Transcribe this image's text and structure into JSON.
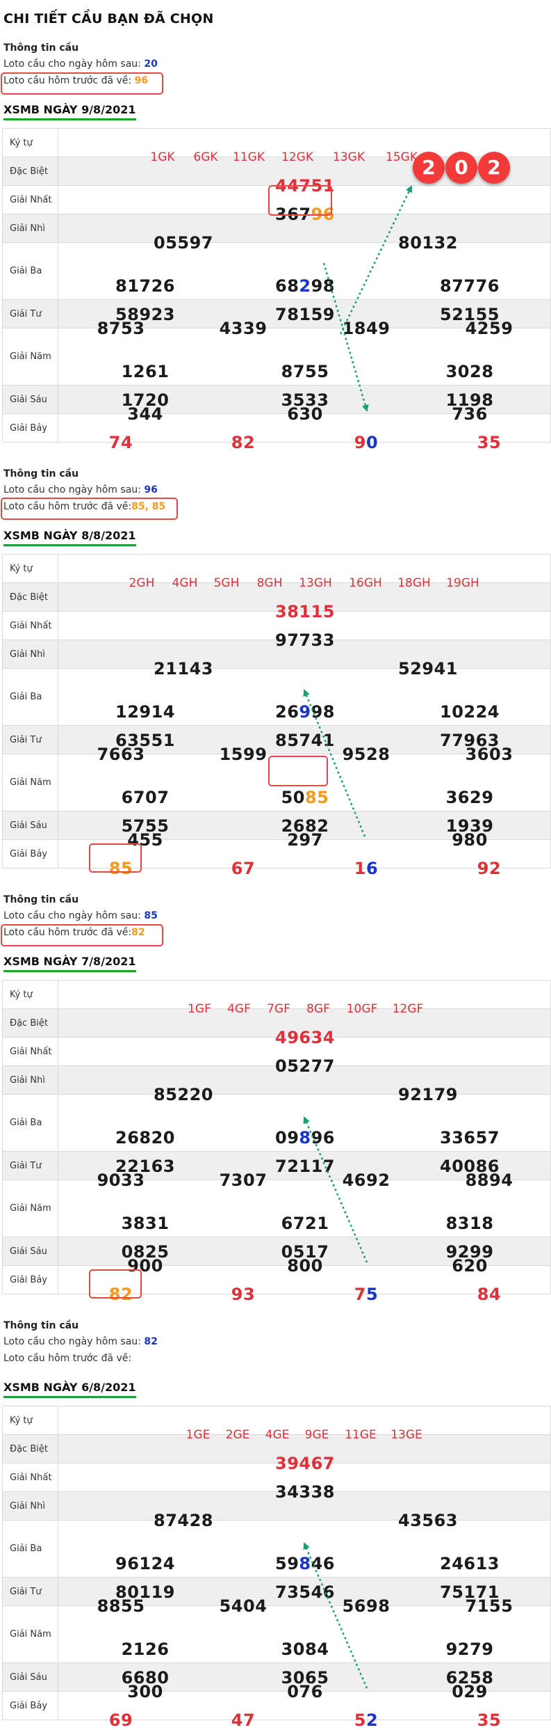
{
  "page_title": "CHI TIẾT CẦU BẠN ĐÃ CHỌN",
  "colors": {
    "red": "#e0303a",
    "blue": "#1a35c7",
    "orange": "#f59a1d",
    "green": "#18a32e",
    "dotted": "#1a9e7a"
  },
  "row_labels": {
    "ky_tu": "Ký tự",
    "db": "Đặc Biệt",
    "g1": "Giải Nhất",
    "g2": "Giải Nhì",
    "g3": "Giải Ba",
    "g4": "Giải Tư",
    "g5": "Giải Năm",
    "g6": "Giải Sáu",
    "g7": "Giải Bảy"
  },
  "badge": [
    "2",
    "0",
    "2"
  ],
  "sections": [
    {
      "info": {
        "heading": "Thông tin cầu",
        "next_label": "Loto cầu cho ngày hôm sau: ",
        "next_value": "20",
        "prev_label": "Loto cầu hôm trước đã về: ",
        "prev_value": "96"
      },
      "title": "XSMB NGÀY 9/8/2021",
      "kytu": [
        "1GK",
        "6GK",
        "11GK",
        "12GK",
        "13GK",
        "15GK"
      ],
      "db": "44751",
      "g1": {
        "a": "367",
        "b": "96"
      },
      "g2": [
        "05597",
        "80132"
      ],
      "g3": [
        {
          "a": "81726",
          "b": "",
          "c": ""
        },
        {
          "a": "68",
          "b": "2",
          "c": "98"
        },
        {
          "a": "87776",
          "b": "",
          "c": ""
        },
        {
          "a": "58923",
          "b": "",
          "c": ""
        },
        {
          "a": "78159",
          "b": "",
          "c": ""
        },
        {
          "a": "52155",
          "b": "",
          "c": ""
        }
      ],
      "g4": [
        "8753",
        "4339",
        "1849",
        "4259"
      ],
      "g5": [
        "1261",
        "8755",
        "3028",
        "1720",
        "3533",
        "1198"
      ],
      "g6": [
        "344",
        "630",
        "736"
      ],
      "g7": [
        {
          "a": "74",
          "b": ""
        },
        {
          "a": "82",
          "b": ""
        },
        {
          "a": "9",
          "b": "0"
        },
        {
          "a": "35",
          "b": ""
        }
      ]
    },
    {
      "info": {
        "heading": "Thông tin cầu",
        "next_label": "Loto cầu cho ngày hôm sau: ",
        "next_value": "96",
        "prev_label": "Loto cầu hôm trước đã về:",
        "prev_value": "85, 85"
      },
      "title": "XSMB NGÀY 8/8/2021",
      "kytu": [
        "2GH",
        "4GH",
        "5GH",
        "8GH",
        "13GH",
        "16GH",
        "18GH",
        "19GH"
      ],
      "db": "38115",
      "g1": "97733",
      "g2": [
        "21143",
        "52941"
      ],
      "g3": [
        {
          "a": "12914",
          "b": "",
          "c": ""
        },
        {
          "a": "26",
          "b": "9",
          "c": "98"
        },
        {
          "a": "10224",
          "b": "",
          "c": ""
        },
        {
          "a": "63551",
          "b": "",
          "c": ""
        },
        {
          "a": "85741",
          "b": "",
          "c": ""
        },
        {
          "a": "77963",
          "b": "",
          "c": ""
        }
      ],
      "g4": [
        "7663",
        "1599",
        "9528",
        "3603"
      ],
      "g5": [
        {
          "a": "6707",
          "b": ""
        },
        {
          "a": "50",
          "b": "85"
        },
        {
          "a": "3629",
          "b": ""
        },
        {
          "a": "5755",
          "b": ""
        },
        {
          "a": "2682",
          "b": ""
        },
        {
          "a": "1939",
          "b": ""
        }
      ],
      "g6": [
        "455",
        "297",
        "980"
      ],
      "g7": [
        {
          "a": "85",
          "b": ""
        },
        {
          "a": "67",
          "b": ""
        },
        {
          "a": "1",
          "b": "6"
        },
        {
          "a": "92",
          "b": ""
        }
      ]
    },
    {
      "info": {
        "heading": "Thông tin cầu",
        "next_label": "Loto cầu cho ngày hôm sau: ",
        "next_value": "85",
        "prev_label": "Loto cầu hôm trước đã về:",
        "prev_value": "82"
      },
      "title": "XSMB NGÀY 7/8/2021",
      "kytu": [
        "1GF",
        "4GF",
        "7GF",
        "8GF",
        "10GF",
        "12GF"
      ],
      "db": "49634",
      "g1": "05277",
      "g2": [
        "85220",
        "92179"
      ],
      "g3": [
        {
          "a": "26820",
          "b": "",
          "c": ""
        },
        {
          "a": "09",
          "b": "8",
          "c": "96"
        },
        {
          "a": "33657",
          "b": "",
          "c": ""
        },
        {
          "a": "22163",
          "b": "",
          "c": ""
        },
        {
          "a": "72117",
          "b": "",
          "c": ""
        },
        {
          "a": "40086",
          "b": "",
          "c": ""
        }
      ],
      "g4": [
        "9033",
        "7307",
        "4692",
        "8894"
      ],
      "g5": [
        "3831",
        "6721",
        "8318",
        "0825",
        "0517",
        "9299"
      ],
      "g6": [
        "900",
        "800",
        "620"
      ],
      "g7": [
        {
          "a": "82",
          "b": ""
        },
        {
          "a": "93",
          "b": ""
        },
        {
          "a": "7",
          "b": "5"
        },
        {
          "a": "84",
          "b": ""
        }
      ]
    },
    {
      "info": {
        "heading": "Thông tin cầu",
        "next_label": "Loto cầu cho ngày hôm sau: ",
        "next_value": "82",
        "prev_label": "Loto cầu hôm trước đã về:",
        "prev_value": ""
      },
      "title": "XSMB NGÀY 6/8/2021",
      "kytu": [
        "1GE",
        "2GE",
        "4GE",
        "9GE",
        "11GE",
        "13GE"
      ],
      "db": "39467",
      "g1": "34338",
      "g2": [
        "87428",
        "43563"
      ],
      "g3": [
        {
          "a": "96124",
          "b": "",
          "c": ""
        },
        {
          "a": "59",
          "b": "8",
          "c": "46"
        },
        {
          "a": "24613",
          "b": "",
          "c": ""
        },
        {
          "a": "80119",
          "b": "",
          "c": ""
        },
        {
          "a": "73546",
          "b": "",
          "c": ""
        },
        {
          "a": "75171",
          "b": "",
          "c": ""
        }
      ],
      "g4": [
        "8855",
        "5404",
        "5698",
        "7155"
      ],
      "g5": [
        "2126",
        "3084",
        "9279",
        "6680",
        "3065",
        "6258"
      ],
      "g6": [
        "300",
        "076",
        "029"
      ],
      "g7": [
        {
          "a": "69",
          "b": ""
        },
        {
          "a": "47",
          "b": ""
        },
        {
          "a": "5",
          "b": "2"
        },
        {
          "a": "35",
          "b": ""
        }
      ]
    }
  ]
}
